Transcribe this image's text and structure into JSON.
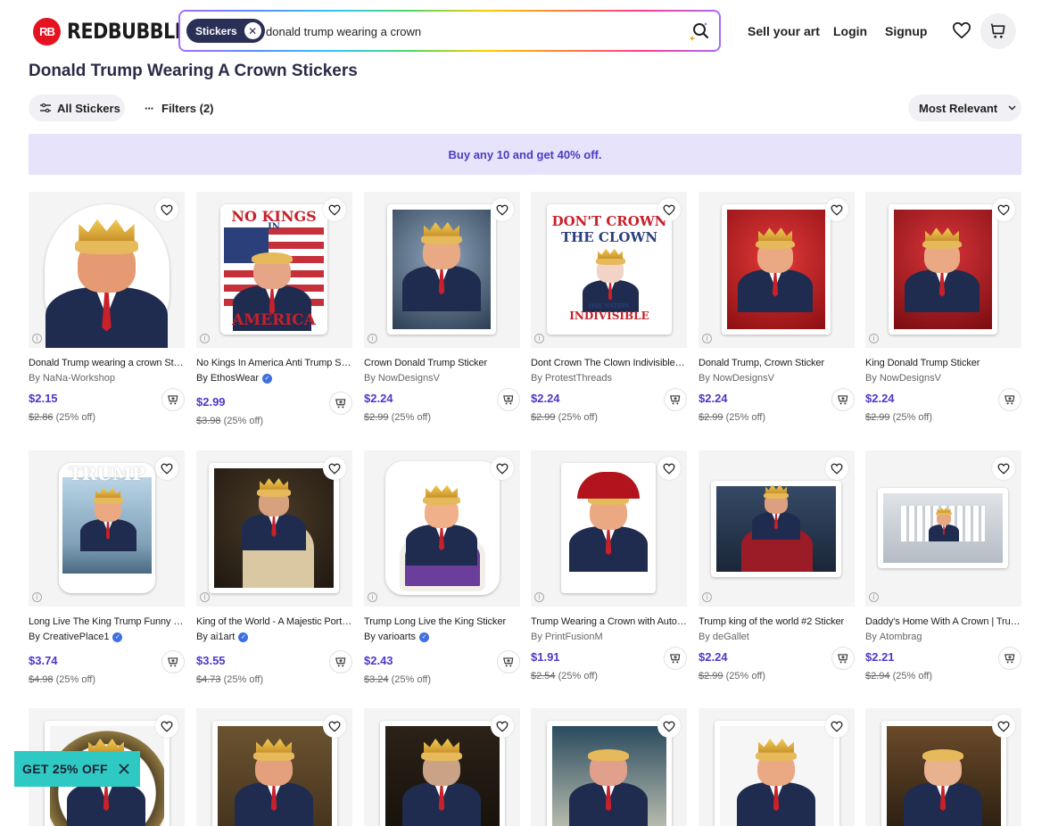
{
  "header": {
    "logo_mark": "RB",
    "logo_text": "REDBUBBLE",
    "search_chip": "Stickers",
    "search_value": "donald trump wearing a crown",
    "nav": {
      "sell": "Sell your art",
      "login": "Login",
      "signup": "Signup"
    }
  },
  "page_title": "Donald Trump Wearing A Crown Stickers",
  "toolbar": {
    "all_label": "All Stickers",
    "filters_label": "Filters (2)",
    "sort_label": "Most Relevant"
  },
  "promo": "Buy any 10 and get 40% off.",
  "products": [
    {
      "title": "Donald Trump wearing a crown Sticker",
      "by": "By",
      "artist": "NaNa-Workshop",
      "verified": false,
      "price": "$2.15",
      "old_price": "$2.86",
      "discount": "(25% off)"
    },
    {
      "title": "No Kings In America Anti Trump Sticker",
      "by": "By",
      "artist": "EthosWear",
      "verified": true,
      "price": "$2.99",
      "old_price": "$3.98",
      "discount": "(25% off)"
    },
    {
      "title": "Crown Donald Trump Sticker",
      "by": "By",
      "artist": "NowDesignsV",
      "verified": false,
      "price": "$2.24",
      "old_price": "$2.99",
      "discount": "(25% off)"
    },
    {
      "title": "Dont Crown The Clown Indivisible Sticker",
      "by": "By",
      "artist": "ProtestThreads",
      "verified": false,
      "price": "$2.24",
      "old_price": "$2.99",
      "discount": "(25% off)"
    },
    {
      "title": "Donald Trump, Crown Sticker",
      "by": "By",
      "artist": "NowDesignsV",
      "verified": false,
      "price": "$2.24",
      "old_price": "$2.99",
      "discount": "(25% off)"
    },
    {
      "title": "King Donald Trump Sticker",
      "by": "By",
      "artist": "NowDesignsV",
      "verified": false,
      "price": "$2.24",
      "old_price": "$2.99",
      "discount": "(25% off)"
    },
    {
      "title": "Long Live The King Trump Funny Sticker",
      "by": "By",
      "artist": "CreativePlace1",
      "verified": true,
      "price": "$3.74",
      "old_price": "$4.98",
      "discount": "(25% off)"
    },
    {
      "title": "King of the World - A Majestic Portrait Sticker",
      "by": "By",
      "artist": "ai1art",
      "verified": true,
      "price": "$3.55",
      "old_price": "$4.73",
      "discount": "(25% off)"
    },
    {
      "title": "Trump Long Live the King Sticker",
      "by": "By",
      "artist": "varioarts",
      "verified": true,
      "price": "$2.43",
      "old_price": "$3.24",
      "discount": "(25% off)"
    },
    {
      "title": "Trump Wearing a Crown with Autograph Sticker",
      "by": "By",
      "artist": "PrintFusionM",
      "verified": false,
      "price": "$1.91",
      "old_price": "$2.54",
      "discount": "(25% off)"
    },
    {
      "title": "Trump king of the world #2 Sticker",
      "by": "By",
      "artist": "deGallet",
      "verified": false,
      "price": "$2.24",
      "old_price": "$2.99",
      "discount": "(25% off)"
    },
    {
      "title": "Daddy's Home With A Crown | Trump Sticker",
      "by": "By",
      "artist": "Atombrag",
      "verified": false,
      "price": "$2.21",
      "old_price": "$2.94",
      "discount": "(25% off)"
    }
  ],
  "sticker_texts": {
    "no_kings_top": "NO KINGS",
    "no_kings_in": "IN",
    "no_kings_bottom": "AMERICA",
    "dont_crown_line1": "DON'T CROWN",
    "dont_crown_line2": "THE CLOWN",
    "one_nation": "ONE NATION",
    "indivisible": "INDIVISIBLE",
    "trump_word": "TRUMP"
  },
  "offer_banner": "GET 25% OFF",
  "colors": {
    "brand_red": "#e41321",
    "price_purple": "#4d38c9",
    "promo_bg": "#e7e3fb",
    "offer_teal": "#2fc9c4"
  }
}
